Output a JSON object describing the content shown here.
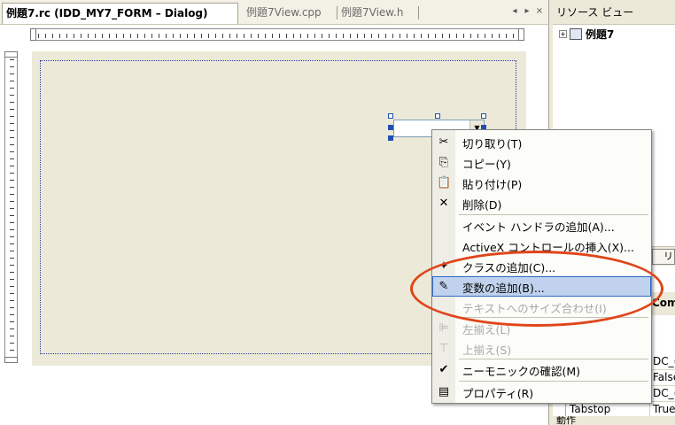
{
  "tabs": [
    {
      "label": "例題7.rc (IDD_MY7_FORM – Dialog)",
      "active": true
    },
    {
      "label": "例題7View.cpp",
      "active": false
    },
    {
      "label": "例題7View.h",
      "active": false
    }
  ],
  "tab_controls": {
    "prev": "◂",
    "next": "▸",
    "close": "×"
  },
  "resource_view": {
    "title": "リソース ビュー",
    "tree_root": "例題7",
    "tree_expander": "+",
    "bottom_button_label": "リ"
  },
  "properties": {
    "header_partial": "Com",
    "rows": [
      {
        "key": "",
        "value": "DC_("
      },
      {
        "key": "",
        "value": "False"
      },
      {
        "key": "",
        "value": "DC_("
      },
      {
        "key": "Tabstop",
        "value": "True"
      }
    ],
    "category_partial": "動作"
  },
  "context_menu": {
    "items": [
      {
        "label": "切り取り(T)",
        "icon": "scissors-icon",
        "glyph": "✂",
        "disabled": false
      },
      {
        "label": "コピー(Y)",
        "icon": "copy-icon",
        "glyph": "⎘",
        "disabled": false
      },
      {
        "label": "貼り付け(P)",
        "icon": "paste-icon",
        "glyph": "📋",
        "disabled": false
      },
      {
        "label": "削除(D)",
        "icon": "delete-icon",
        "glyph": "✕",
        "disabled": false
      },
      {
        "label": "イベント ハンドラの追加(A)...",
        "icon": "",
        "glyph": "",
        "disabled": false
      },
      {
        "label": "ActiveX コントロールの挿入(X)...",
        "icon": "",
        "glyph": "",
        "disabled": false
      },
      {
        "label": "クラスの追加(C)...",
        "icon": "add-class-icon",
        "glyph": "✦",
        "disabled": false
      },
      {
        "label": "変数の追加(B)...",
        "icon": "add-variable-icon",
        "glyph": "✎",
        "disabled": false,
        "highlighted": true
      },
      {
        "label": "テキストへのサイズ合わせ(I)",
        "icon": "",
        "glyph": "",
        "disabled": true
      },
      {
        "label": "左揃え(L)",
        "icon": "align-left-icon",
        "glyph": "⊫",
        "disabled": true
      },
      {
        "label": "上揃え(S)",
        "icon": "align-top-icon",
        "glyph": "⊤",
        "disabled": true
      },
      {
        "label": "ニーモニックの確認(M)",
        "icon": "check-mnemonic-icon",
        "glyph": "✔",
        "disabled": false
      },
      {
        "label": "プロパティ(R)",
        "icon": "properties-icon",
        "glyph": "▤",
        "disabled": false
      }
    ]
  },
  "colors": {
    "highlight": "#c1d2ee",
    "highlight_border": "#316ac5",
    "annotation_oval": "#e0451a",
    "dialog_face": "#ece9d8"
  }
}
